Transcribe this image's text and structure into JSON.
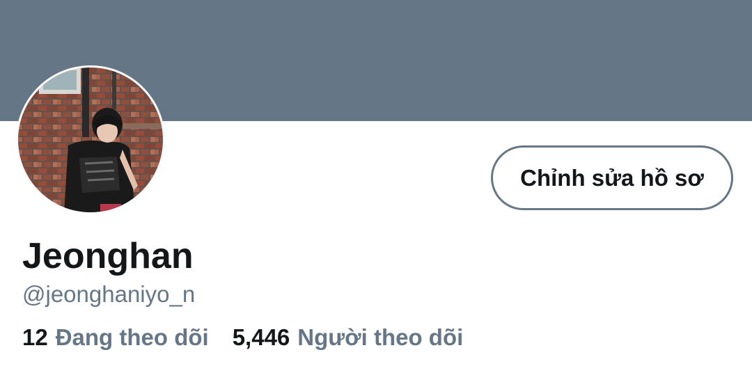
{
  "theme": {
    "banner_color": "#657786",
    "text_primary": "#14171a",
    "text_secondary": "#657786"
  },
  "profile": {
    "avatar_icon": "profile-photo",
    "edit_button_label": "Chỉnh sửa hồ sơ",
    "display_name": "Jeonghan",
    "handle": "@jeonghaniyo_n",
    "following_count": "12",
    "following_label": "Đang theo dõi",
    "followers_count": "5,446",
    "followers_label": "Người theo dõi"
  }
}
